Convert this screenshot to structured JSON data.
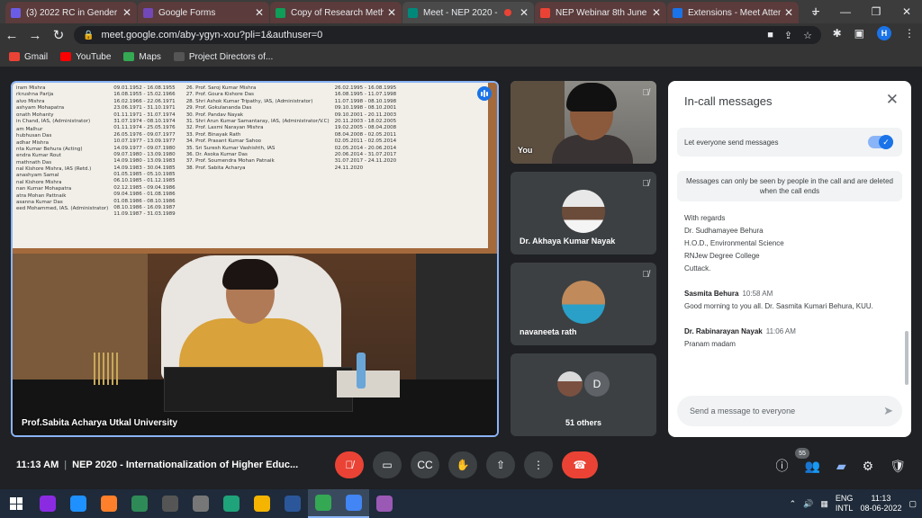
{
  "browser": {
    "tabs": [
      {
        "title": "(3) 2022 RC in Gender St",
        "color": "#6b5ce7",
        "active": false,
        "recording": false
      },
      {
        "title": "Google Forms",
        "color": "#7248b9",
        "active": false,
        "recording": false
      },
      {
        "title": "Copy of Research Meth",
        "color": "#0f9d58",
        "active": false,
        "recording": false
      },
      {
        "title": "Meet - NEP 2020 -",
        "color": "#00897b",
        "active": true,
        "recording": true
      },
      {
        "title": "NEP Webinar 8th June",
        "color": "#ea4335",
        "active": false,
        "recording": false
      },
      {
        "title": "Extensions - Meet Atten",
        "color": "#1a73e8",
        "active": false,
        "recording": false
      }
    ],
    "url": "meet.google.com/aby-ygyn-xou?pli=1&authuser=0",
    "profile_initial": "H",
    "bookmarks": [
      {
        "label": "Gmail",
        "color": "#ea4335"
      },
      {
        "label": "YouTube",
        "color": "#ff0000"
      },
      {
        "label": "Maps",
        "color": "#34a853"
      },
      {
        "label": "Project Directors of...",
        "color": "#555555"
      }
    ]
  },
  "meet": {
    "main_speaker": "Prof.Sabita Acharya Utkal University",
    "board": {
      "col1": [
        "iram Mishra",
        "rkrushna Parija",
        "alvo Mishra",
        "ashyam Mohapatra",
        "onath Mohanty",
        "in Chand, IAS, (Administrator)",
        "",
        "am Malhur",
        "hubhusan Das",
        "adhar Mishra",
        "nta Kumar Behura (Acting)",
        "endra Kumar Rout",
        "mathnath Das",
        "nal Kishore Mishra, IAS (Retd.)",
        "anashyam Samal",
        "nal Kishore Mishra",
        "nan Kumar Mohapatra",
        "atra Mohan Pattnaik",
        "asanna Kumar Das",
        "eed Mohammed, IAS. (Administrator)"
      ],
      "col2": [
        "09.01.1952 - 16.08.1955",
        "16.08.1955 - 15.02.1966",
        "16.02.1966 - 22.06.1971",
        "23.06.1971 - 31.10.1971",
        "01.11.1971 - 31.07.1974",
        "31.07.1974 - 08.10.1974",
        "01.11.1974 - 25.05.1976",
        "26.05.1976 - 09.07.1977",
        "10.07.1977 - 13.09.1977",
        "14.09.1977 - 09.07.1980",
        "09.07.1980 - 13.09.1980",
        "14.09.1980 - 13.09.1983",
        "14.09.1983 - 30.04.1985",
        "01.05.1985 - 05.10.1985",
        "06.10.1985 - 01.12.1985",
        "02.12.1985 - 09.04.1986",
        "09.04.1986 - 01.08.1986",
        "01.08.1986 - 08.10.1986",
        "08.10.1986 - 16.09.1987",
        "11.09.1987 - 31.03.1989"
      ],
      "col3": [
        "26.  Prof. Saroj Kumar Mishra",
        "27.  Prof. Goura Kishore Das",
        "28.  Shri Ashok Kumar Tripathy, IAS, (Administrator)",
        "29.  Prof. Gokulananda Das",
        "30.  Prof. Pandav Nayak",
        "31.  Shri Arun Kumar Samantaray, IAS, (Administrator/V.C)",
        "32.  Prof. Laxmi Narayan Mishra",
        "33.  Prof. Binayak Rath",
        "34.  Prof. Prasant Kumar Sahoo",
        "35.  Sri Suresh Kumar Vashishth, IAS",
        "36.  Dr. Asoka Kumar Das",
        "37.  Prof. Soumendra Mohan Patnaik",
        "38.  Prof. Sabita Acharya"
      ],
      "col4": [
        "26.02.1995 - 16.08.1995",
        "16.08.1995 - 11.07.1998",
        "11.07.1998 - 08.10.1998",
        "09.10.1998 - 08.10.2001",
        "09.10.2001 - 20.11.2003",
        "20.11.2003 - 18.02.2005",
        "19.02.2005 - 08.04.2008",
        "08.04.2008 - 02.05.2011",
        "02.05.2011 - 02.05.2014",
        "02.05.2014 - 20.06.2014",
        "20.06.2014 - 31.07.2017",
        "31.07.2017 - 24.11.2020",
        "24.11.2020"
      ]
    },
    "self_label": "You",
    "participants": [
      {
        "name": "Dr. Akhaya Kumar Nayak"
      },
      {
        "name": "navaneeta rath"
      }
    ],
    "others": {
      "initial": "D",
      "label": "51 others"
    },
    "time": "11:13 AM",
    "meeting_title": "NEP 2020 - Internationalization of Higher Educ...",
    "participant_count": "55"
  },
  "chat": {
    "title": "In-call messages",
    "setting_label": "Let everyone send messages",
    "info": "Messages can only be seen by people in the call and are deleted when the call ends",
    "messages": [
      {
        "sender": "",
        "time": "",
        "lines": [
          "With regards",
          "Dr. Sudhamayee Behura",
          "H.O.D., Environmental Science",
          "RNJew Degree College",
          "Cuttack."
        ]
      },
      {
        "sender": "Sasmita Behura",
        "time": "10:58 AM",
        "lines": [
          "Good morning to you all. Dr. Sasmita Kumari Behura, KUU."
        ]
      },
      {
        "sender": "Dr. Rabinarayan Nayak",
        "time": "11:06 AM",
        "lines": [
          "Pranam madam"
        ]
      }
    ],
    "input_placeholder": "Send a message to everyone"
  },
  "taskbar": {
    "apps": [
      {
        "name": "winrar-icon",
        "color": "#8a2be2",
        "open": false
      },
      {
        "name": "ie-icon",
        "color": "#1e90ff",
        "open": false
      },
      {
        "name": "firefox-icon",
        "color": "#ff7f2a",
        "open": false
      },
      {
        "name": "store-icon",
        "color": "#2e8b57",
        "open": false
      },
      {
        "name": "calculator-icon",
        "color": "#555555",
        "open": false
      },
      {
        "name": "printer-icon",
        "color": "#777777",
        "open": false
      },
      {
        "name": "edge-icon",
        "color": "#1fa37a",
        "open": false
      },
      {
        "name": "chrome-icon",
        "color": "#f4b400",
        "open": false
      },
      {
        "name": "word-icon",
        "color": "#2b579a",
        "open": false
      },
      {
        "name": "chrome-icon-2",
        "color": "#34a853",
        "open": true
      },
      {
        "name": "chrome-icon-3",
        "color": "#4285f4",
        "open": true
      },
      {
        "name": "chrome-canary-icon",
        "color": "#9b59b6",
        "open": false
      }
    ],
    "lang": "ENG",
    "region": "INTL",
    "time": "11:13",
    "date": "08-06-2022"
  }
}
